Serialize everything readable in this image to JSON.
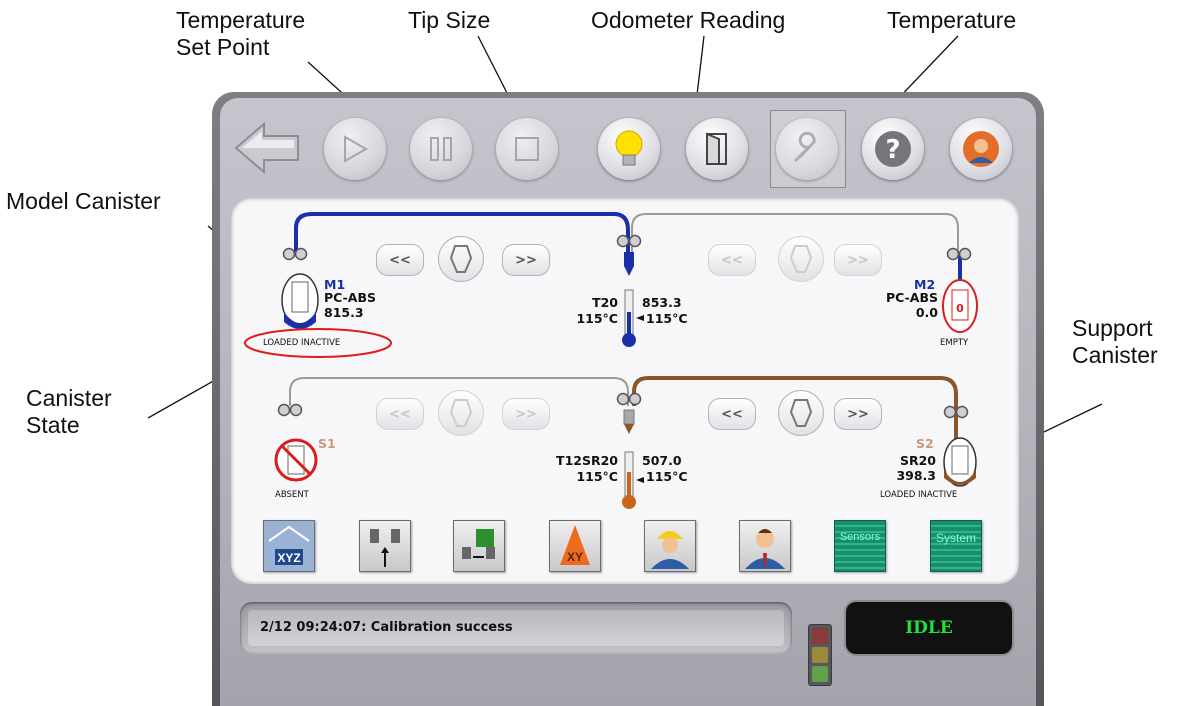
{
  "callouts": {
    "temp_set_point_line1": "Temperature",
    "temp_set_point_line2": "Set Point",
    "tip_size": "Tip Size",
    "odometer": "Odometer Reading",
    "temperature": "Temperature",
    "model_canister": "Model Canister",
    "canister_state_line1": "Canister",
    "canister_state_line2": "State",
    "support_canister_line1": "Support",
    "support_canister_line2": "Canister"
  },
  "model_bays": {
    "m1": {
      "label": "M1",
      "material": "PC-ABS",
      "volume": "815.3",
      "state": "LOADED INACTIVE"
    },
    "m2": {
      "label": "M2",
      "material": "PC-ABS",
      "volume": "0.0",
      "state": "EMPTY"
    }
  },
  "support_bays": {
    "s1": {
      "label": "S1",
      "state": "ABSENT"
    },
    "s2": {
      "label": "S2",
      "material": "SR20",
      "volume": "398.3",
      "state": "LOADED INACTIVE"
    }
  },
  "model_head": {
    "tip": "T20",
    "setpoint": "115°C",
    "odometer": "853.3",
    "temperature": "115°C"
  },
  "support_head": {
    "tip": "T12SR20",
    "setpoint": "115°C",
    "odometer": "507.0",
    "temperature": "115°C"
  },
  "feed_controls": {
    "rewind": "<<",
    "forward": ">>"
  },
  "toolbar": [
    "back-arrow-icon",
    "play-icon",
    "pause-icon",
    "stop-icon",
    "light-bulb-icon",
    "door-icon",
    "wrench-icon",
    "help-icon",
    "user-icon"
  ],
  "tools": {
    "xyz": "XYZ",
    "xy": "XY",
    "sensors": "Sensors",
    "system": "System"
  },
  "status": {
    "message": "2/12 09:24:07: Calibration success",
    "state": "IDLE"
  },
  "colors": {
    "model": "#1b2fa8",
    "support": "#8a5528",
    "inactive_line": "#9a9a9a",
    "state_circle": "#e21b1b",
    "status_green": "#1fe33d"
  }
}
